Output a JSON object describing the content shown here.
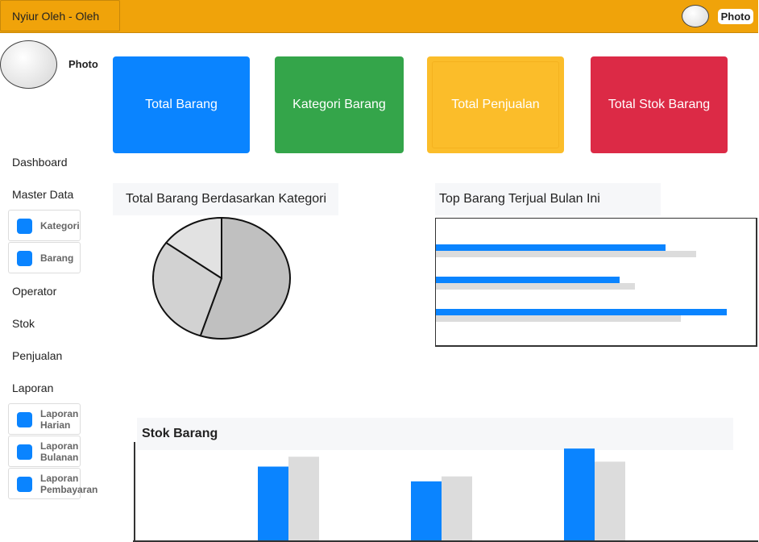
{
  "topbar": {
    "brand": "Nyiur Oleh - Oleh",
    "photo_label": "Photo"
  },
  "sidebar": {
    "photo_label": "Photo",
    "menu": {
      "dashboard": "Dashboard",
      "master_data": "Master Data",
      "master_sub": [
        "Kategori",
        "Barang"
      ],
      "operator": "Operator",
      "stok": "Stok",
      "penjualan": "Penjualan",
      "laporan": "Laporan",
      "laporan_sub": [
        "Laporan Harian",
        "Laporan Bulanan",
        "Laporan Pembayaran"
      ]
    }
  },
  "cards": [
    {
      "label": "Total Barang",
      "color": "#0a84ff"
    },
    {
      "label": "Kategori Barang",
      "color": "#34a54a"
    },
    {
      "label": "Total Penjualan",
      "color": "#fbbd2a"
    },
    {
      "label": "Total Stok Barang",
      "color": "#dc2a46"
    }
  ],
  "panels": {
    "pie_title": "Total Barang Berdasarkan Kategori",
    "hbar_title": "Top Barang Terjual Bulan Ini",
    "vbar_title": "Stok Barang"
  },
  "chart_data": [
    {
      "type": "pie",
      "title": "Total Barang Berdasarkan Kategori",
      "slices": [
        {
          "value": 55,
          "color": "#c0c0c0"
        },
        {
          "value": 30,
          "color": "#d2d2d2"
        },
        {
          "value": 15,
          "color": "#e2e2e2"
        }
      ]
    },
    {
      "type": "bar",
      "orientation": "horizontal",
      "title": "Top Barang Terjual Bulan Ini",
      "xlim": [
        0,
        100
      ],
      "series": [
        {
          "color": "#0a84ff",
          "values": [
            75,
            60,
            95
          ]
        },
        {
          "color": "#dcdcdc",
          "values": [
            85,
            65,
            80
          ]
        }
      ]
    },
    {
      "type": "bar",
      "title": "Stok Barang",
      "ylim": [
        0,
        120
      ],
      "series": [
        {
          "color": "#0a84ff",
          "values": [
            90,
            72,
            112
          ]
        },
        {
          "color": "#dcdcdc",
          "values": [
            102,
            78,
            96
          ]
        }
      ]
    }
  ]
}
